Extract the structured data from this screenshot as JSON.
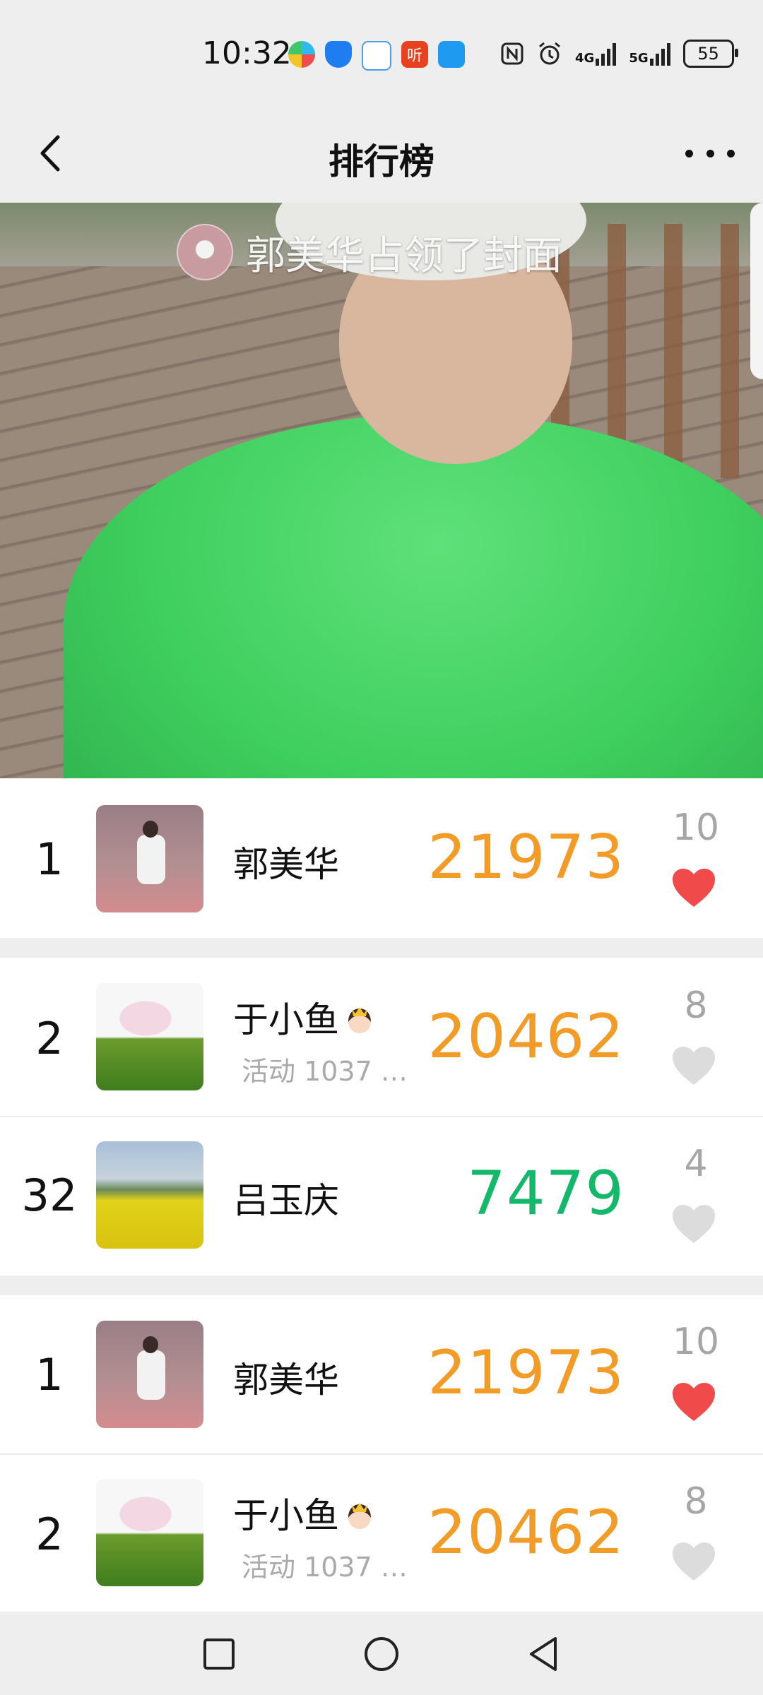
{
  "status_bar": {
    "time": "10:32",
    "app_icons": [
      "colorful-app-icon",
      "shield-icon",
      "chat-bubble-icon",
      "ting-app-icon",
      "message-icon"
    ],
    "ting_label": "听",
    "network_4g": "4G",
    "network_5g": "5G",
    "battery": "55"
  },
  "header": {
    "title": "排行榜"
  },
  "cover": {
    "banner_text": "郭美华占领了封面"
  },
  "rows": [
    {
      "rank": "1",
      "name": "郭美华",
      "sub": "",
      "score": "21973",
      "score_color": "#f29b27",
      "likes": "10",
      "liked": true,
      "thumb": "guo"
    },
    {
      "rank": "2",
      "name": "于小鱼",
      "sub": "活动 1037 …",
      "score": "20462",
      "score_color": "#f29b27",
      "likes": "8",
      "liked": false,
      "thumb": "yu"
    },
    {
      "rank": "32",
      "name": "吕玉庆",
      "sub": "",
      "score": "7479",
      "score_color": "#14b86a",
      "likes": "4",
      "liked": false,
      "thumb": "lv"
    },
    {
      "rank": "1",
      "name": "郭美华",
      "sub": "",
      "score": "21973",
      "score_color": "#f29b27",
      "likes": "10",
      "liked": true,
      "thumb": "guo"
    },
    {
      "rank": "2",
      "name": "于小鱼",
      "sub": "活动 1037 …",
      "score": "20462",
      "score_color": "#f29b27",
      "likes": "8",
      "liked": false,
      "thumb": "yu"
    }
  ],
  "colors": {
    "liked_heart": "#f04a4a",
    "unliked_heart": "#dcdcdc",
    "score_orange": "#f29b27",
    "score_green": "#14b86a"
  },
  "nav_bar": [
    "recents-square-icon",
    "home-circle-icon",
    "back-triangle-icon"
  ]
}
